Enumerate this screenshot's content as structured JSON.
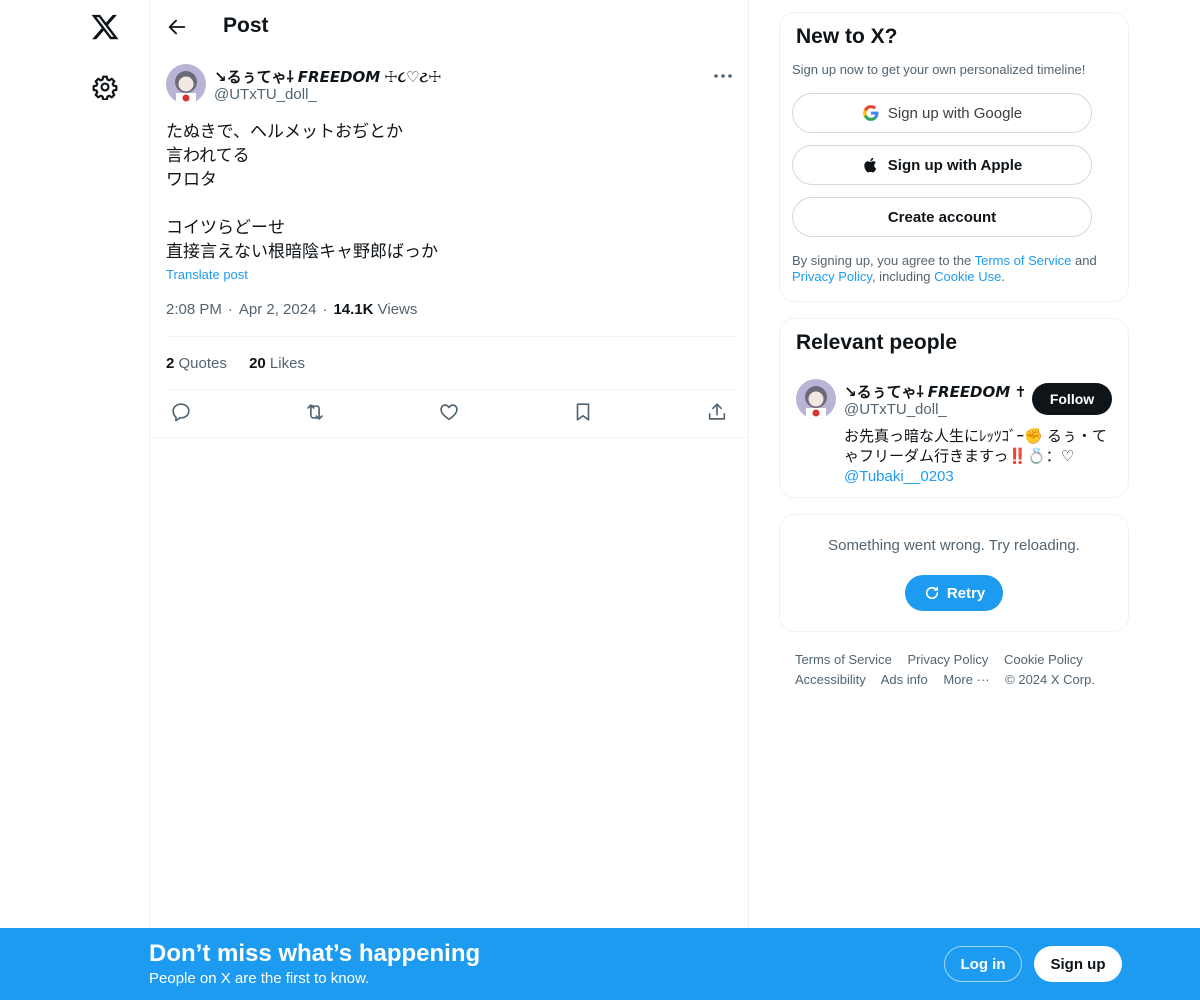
{
  "header": {
    "title": "Post"
  },
  "post": {
    "author_name": "⁠↘⁠⁠るぅてゃ⸸ 𝙁𝙍𝙀𝙀𝘿𝙊𝙈 ☩૮♡ટ☩",
    "author_handle": "@UTxTU_doll_",
    "text": "たぬきで、ヘルメットおぢとか\n言われてる\nワロタ\n\nコイツらどーせ\n直接言えない根暗陰キャ野郎ばっか",
    "translate_label": "Translate post",
    "time": "2:08 PM",
    "date": "Apr 2, 2024",
    "views_count": "14.1K",
    "views_label": "Views",
    "quotes_count": "2",
    "quotes_label": "Quotes",
    "likes_count": "20",
    "likes_label": "Likes"
  },
  "signup_card": {
    "title": "New to X?",
    "subtitle": "Sign up now to get your own personalized timeline!",
    "google_label": "Sign up with Google",
    "apple_label": "Sign up with Apple",
    "create_label": "Create account",
    "legal_prefix": "By signing up, you agree to the ",
    "terms_link": "Terms of Service",
    "legal_and": " and ",
    "privacy_link": "Privacy Policy",
    "legal_including": ", including ",
    "cookie_link": "Cookie Use",
    "legal_end": "."
  },
  "relevant_people": {
    "title": "Relevant people",
    "name": "⁠↘⁠⁠るぅてゃ⸸ 𝙁𝙍𝙀𝙀𝘿𝙊𝙈 ✝",
    "handle": "@UTxTU_doll_",
    "follow_label": "Follow",
    "bio_text": "お先真っ暗な人生にﾚｯﾂｺﾞｰ✊ るぅ・てゃフリーダム行きますっ‼️💍：♡",
    "bio_link": "@Tubaki__0203"
  },
  "error_card": {
    "message": "Something went wrong. Try reloading.",
    "retry_label": "Retry"
  },
  "footer": {
    "terms": "Terms of Service",
    "privacy": "Privacy Policy",
    "cookie": "Cookie Policy",
    "accessibility": "Accessibility",
    "ads": "Ads info",
    "more": "More ···",
    "copyright": "© 2024 X Corp."
  },
  "banner": {
    "title": "Don’t miss what’s happening",
    "subtitle": "People on X are the first to know.",
    "login_label": "Log in",
    "signup_label": "Sign up"
  },
  "colors": {
    "accent": "#1d9bf0",
    "text_primary": "#0f1419",
    "text_secondary": "#536471",
    "border": "#eff3f4"
  }
}
